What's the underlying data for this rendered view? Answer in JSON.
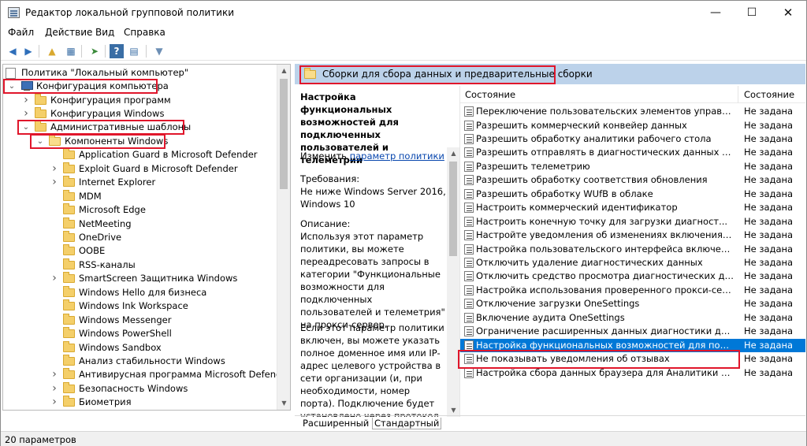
{
  "window": {
    "title": "Редактор локальной групповой политики"
  },
  "menu": [
    "Файл",
    "Действие",
    "Вид",
    "Справка"
  ],
  "tree": {
    "root": "Политика \"Локальный компьютер\"",
    "items": [
      {
        "label": "Конфигурация компьютера",
        "level": 0,
        "expand": "open",
        "icon": "computer-icon"
      },
      {
        "label": "Конфигурация программ",
        "level": 1,
        "expand": "closed",
        "icon": "folder-icon"
      },
      {
        "label": "Конфигурация Windows",
        "level": 1,
        "expand": "closed",
        "icon": "folder-icon"
      },
      {
        "label": "Административные шаблоны",
        "level": 1,
        "expand": "open",
        "icon": "folder-icon"
      },
      {
        "label": "Компоненты Windows",
        "level": 2,
        "expand": "open",
        "icon": "folder-open-icon"
      },
      {
        "label": "Application Guard в Microsoft Defender",
        "level": 3,
        "expand": "none",
        "icon": "folder-icon"
      },
      {
        "label": "Exploit Guard в Microsoft Defender",
        "level": 3,
        "expand": "closed",
        "icon": "folder-icon"
      },
      {
        "label": "Internet Explorer",
        "level": 3,
        "expand": "closed",
        "icon": "folder-icon"
      },
      {
        "label": "MDM",
        "level": 3,
        "expand": "none",
        "icon": "folder-icon"
      },
      {
        "label": "Microsoft Edge",
        "level": 3,
        "expand": "none",
        "icon": "folder-icon"
      },
      {
        "label": "NetMeeting",
        "level": 3,
        "expand": "none",
        "icon": "folder-icon"
      },
      {
        "label": "OneDrive",
        "level": 3,
        "expand": "none",
        "icon": "folder-icon"
      },
      {
        "label": "OOBE",
        "level": 3,
        "expand": "none",
        "icon": "folder-icon"
      },
      {
        "label": "RSS-каналы",
        "level": 3,
        "expand": "none",
        "icon": "folder-icon"
      },
      {
        "label": "SmartScreen Защитника Windows",
        "level": 3,
        "expand": "closed",
        "icon": "folder-icon"
      },
      {
        "label": "Windows Hello для бизнеса",
        "level": 3,
        "expand": "none",
        "icon": "folder-icon"
      },
      {
        "label": "Windows Ink Workspace",
        "level": 3,
        "expand": "none",
        "icon": "folder-icon"
      },
      {
        "label": "Windows Messenger",
        "level": 3,
        "expand": "none",
        "icon": "folder-icon"
      },
      {
        "label": "Windows PowerShell",
        "level": 3,
        "expand": "none",
        "icon": "folder-icon"
      },
      {
        "label": "Windows Sandbox",
        "level": 3,
        "expand": "none",
        "icon": "folder-icon"
      },
      {
        "label": "Анализ стабильности Windows",
        "level": 3,
        "expand": "none",
        "icon": "folder-icon"
      },
      {
        "label": "Антивирусная программа Microsoft Defender",
        "level": 3,
        "expand": "closed",
        "icon": "folder-icon"
      },
      {
        "label": "Безопасность Windows",
        "level": 3,
        "expand": "closed",
        "icon": "folder-icon"
      },
      {
        "label": "Биометрия",
        "level": 3,
        "expand": "closed",
        "icon": "folder-icon"
      }
    ]
  },
  "right": {
    "header_title": "Сборки для сбора данных и предварительные сборки",
    "description": {
      "title": "Настройка функциональных возможностей для подключенных пользователей и телеметрии",
      "edit_prefix": "Изменить",
      "edit_link": "параметр политики",
      "requirements_label": "Требования:",
      "requirements": "Не ниже Windows Server 2016, Windows 10",
      "desc_label": "Описание:",
      "desc_p1": "Используя этот параметр политики, вы можете переадресовать запросы в категории \"Функциональные возможности для подключенных пользователей и телеметрия\" на прокси-сервер.",
      "desc_p2": "Если этот параметр политики включен, вы можете указать полное доменное имя или IP-адрес целевого устройства в сети организации (и, при необходимости, номер порта). Подключение будет установлено через протокол"
    },
    "list": {
      "col_name": "Состояние",
      "col_state": "Состояние",
      "rows": [
        {
          "name": "Переключение пользовательских элементов управления...",
          "state": "Не задана"
        },
        {
          "name": "Разрешить коммерческий конвейер данных",
          "state": "Не задана"
        },
        {
          "name": "Разрешить обработку аналитики рабочего стола",
          "state": "Не задана"
        },
        {
          "name": "Разрешить отправлять в диагностических данных Window...",
          "state": "Не задана"
        },
        {
          "name": "Разрешить телеметрию",
          "state": "Не задана"
        },
        {
          "name": "Разрешить обработку соответствия обновления",
          "state": "Не задана"
        },
        {
          "name": "Разрешить обработку WUfB в облаке",
          "state": "Не задана"
        },
        {
          "name": "Настроить коммерческий идентификатор",
          "state": "Не задана"
        },
        {
          "name": "Настроить конечную точку для загрузки диагност...",
          "state": "Не задана"
        },
        {
          "name": "Настройте уведомления об изменениях включения теле...",
          "state": "Не задана"
        },
        {
          "name": "Настройка пользовательского интерфейса включения те...",
          "state": "Не задана"
        },
        {
          "name": "Отключить удаление диагностических данных",
          "state": "Не задана"
        },
        {
          "name": "Отключить средство просмотра диагностических данных...",
          "state": "Не задана"
        },
        {
          "name": "Настройка использования проверенного прокси-сервер...",
          "state": "Не задана"
        },
        {
          "name": "Отключение загрузки OneSettings",
          "state": "Не задана"
        },
        {
          "name": "Включение аудита OneSettings",
          "state": "Не задана"
        },
        {
          "name": "Ограничение расширенных данных диагностики до треб...",
          "state": "Не задана"
        },
        {
          "name": "Настройка функциональных возможностей для подклю...",
          "state": "Не задана"
        },
        {
          "name": "Не показывать уведомления об отзывах",
          "state": "Не задана"
        },
        {
          "name": "Настройка сбора данных браузера для Аналитики компь...",
          "state": "Не задана"
        }
      ]
    },
    "tabs": [
      "Расширенный",
      "Стандартный"
    ]
  },
  "status": "20 параметров",
  "colors": {
    "selection": "#0078d7",
    "highlight_box": "#e0162b",
    "header_bg": "#bcd2ea"
  }
}
